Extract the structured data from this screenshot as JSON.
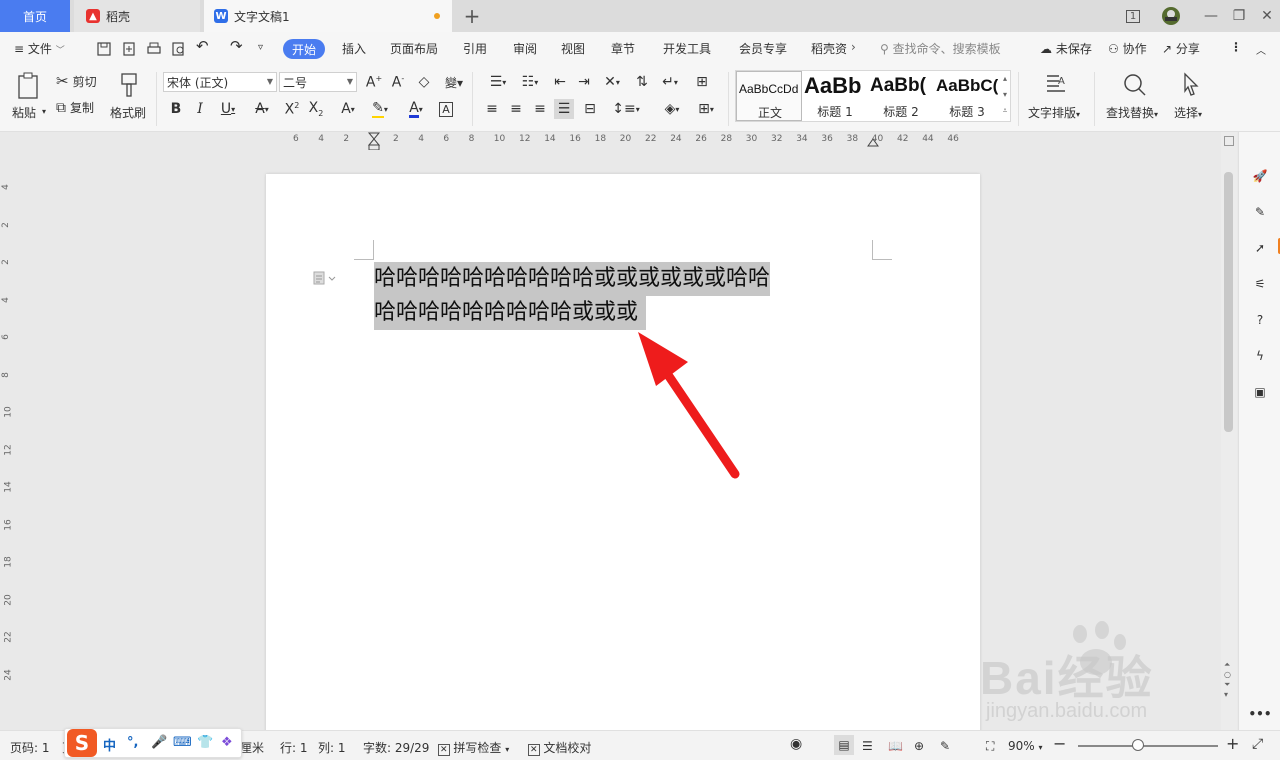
{
  "tabs": {
    "home": "首页",
    "daoke": "稻壳",
    "doc": "文字文稿1",
    "add": "+"
  },
  "window": {
    "page_indicator": "1"
  },
  "menu": {
    "file": "文件",
    "items": [
      "开始",
      "插入",
      "页面布局",
      "引用",
      "审阅",
      "视图",
      "章节",
      "开发工具",
      "会员专享",
      "稻壳资"
    ],
    "search_placeholder": "查找命令、搜索模板",
    "unsaved": "未保存",
    "collab": "协作",
    "share": "分享"
  },
  "ribbon": {
    "paste": "粘贴",
    "cut": "剪切",
    "copy": "复制",
    "format_painter": "格式刷",
    "font_name": "宋体 (正文)",
    "font_size": "二号",
    "styles": [
      {
        "sample": "AaBbCcDd",
        "name": "正文"
      },
      {
        "sample": "AaBb",
        "name": "标题 1"
      },
      {
        "sample": "AaBb(",
        "name": "标题 2"
      },
      {
        "sample": "AaBbC(",
        "name": "标题 3"
      }
    ],
    "text_layout": "文字排版",
    "find_replace": "查找替换",
    "select": "选择"
  },
  "ruler": {
    "h_ticks": [
      "6",
      "4",
      "2",
      "2",
      "4",
      "6",
      "8",
      "10",
      "12",
      "14",
      "16",
      "18",
      "20",
      "22",
      "24",
      "26",
      "28",
      "30",
      "32",
      "34",
      "36",
      "38",
      "40",
      "42",
      "44",
      "46"
    ],
    "v_ticks": [
      "4",
      "2",
      "2",
      "4",
      "6",
      "8",
      "10",
      "12",
      "14",
      "16",
      "18",
      "20",
      "22",
      "24"
    ]
  },
  "document": {
    "line1": "哈哈哈哈哈哈哈哈哈哈或或或或或或哈哈",
    "line2": "哈哈哈哈哈哈哈哈哈或或或"
  },
  "statusbar": {
    "page": "页码: 1",
    "page2": "页",
    "unit": "厘米",
    "row": "行: 1",
    "col": "列: 1",
    "word_count": "字数: 29/29",
    "spell_check": "拼写检查",
    "doc_proof": "文档校对",
    "zoom": "90%"
  },
  "ime": {
    "mode": "中",
    "punct": "°,"
  },
  "watermark": {
    "brand": "Bai经验",
    "url": "jingyan.baidu.com"
  },
  "colors": {
    "accent": "#4a7cf0",
    "arrow": "#ee1c1c",
    "selection": "#c6c6c6"
  }
}
